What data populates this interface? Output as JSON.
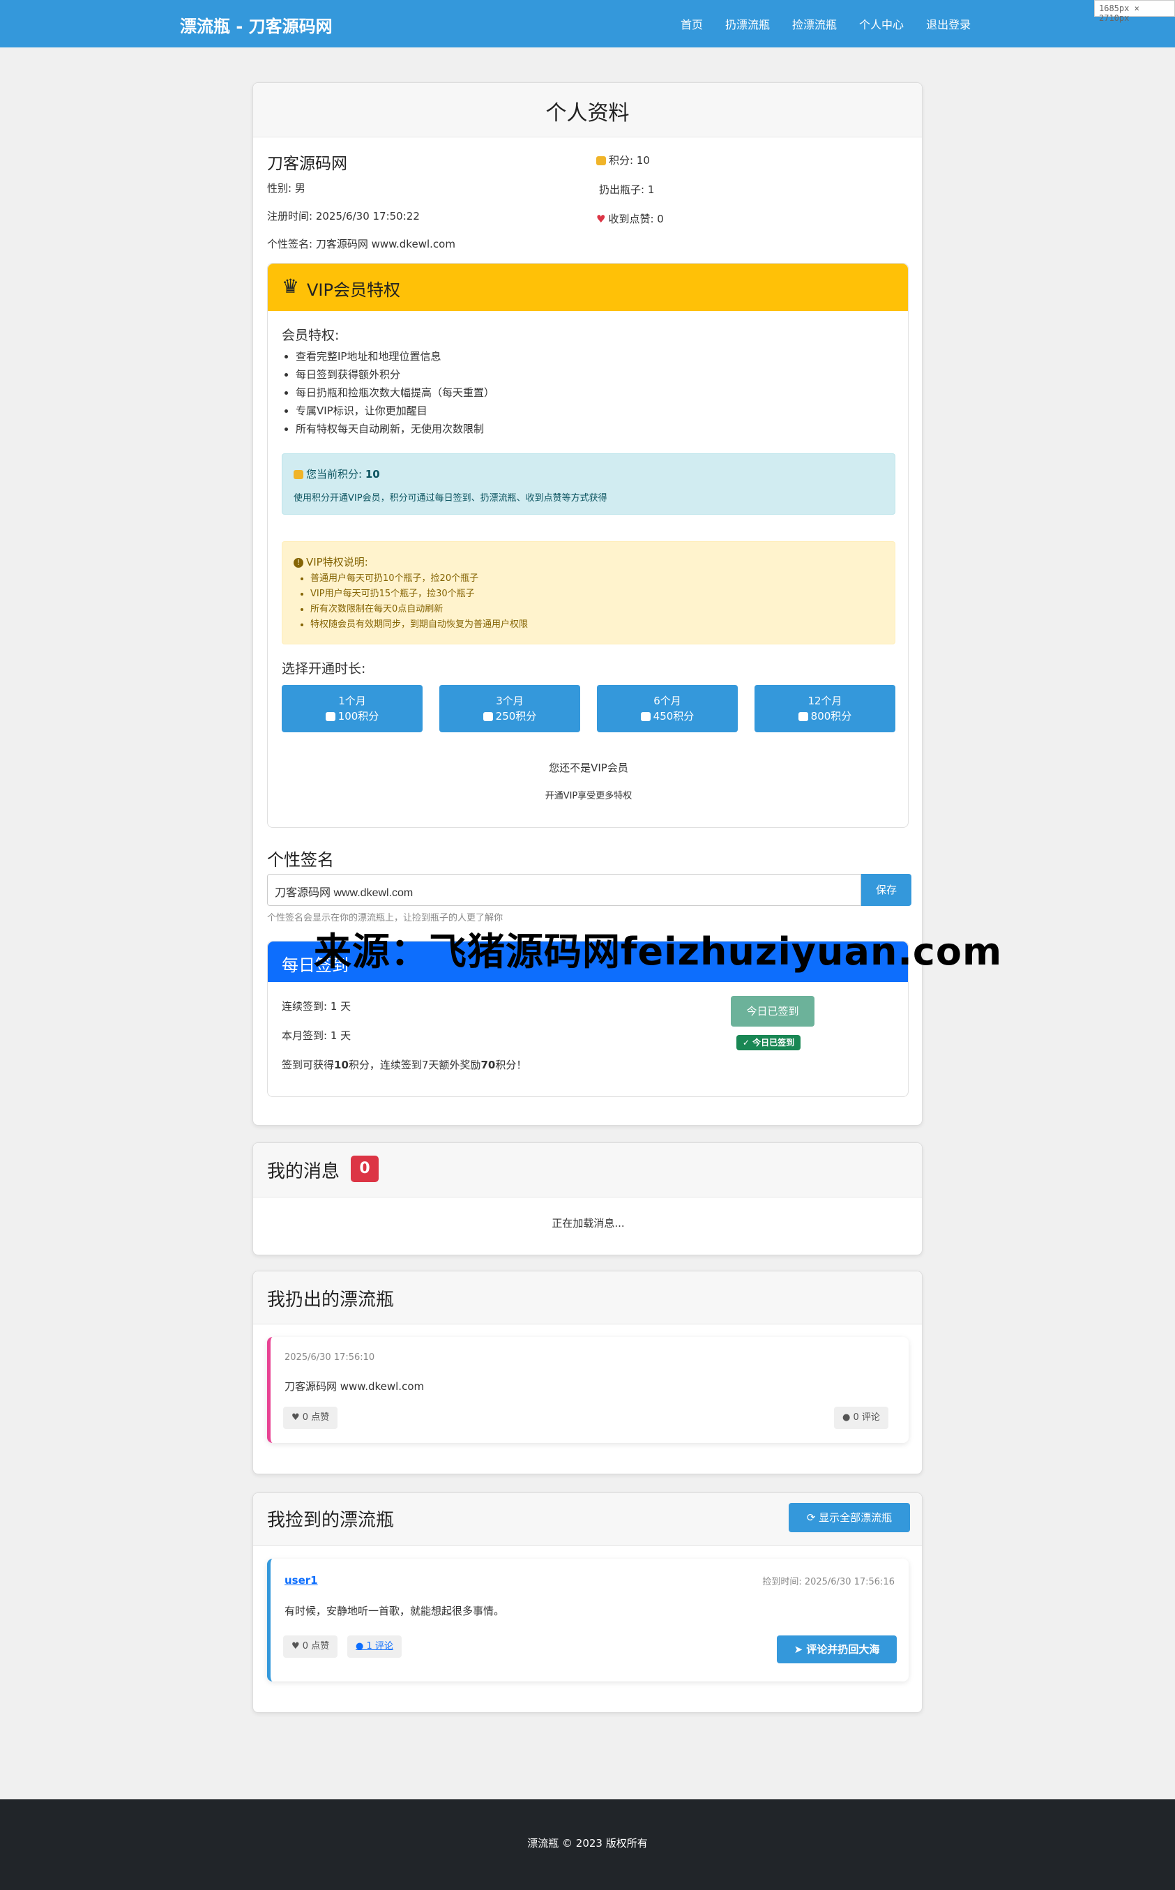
{
  "navbar": {
    "brand": "漂流瓶 - 刀客源码网",
    "links": [
      "首页",
      "扔漂流瓶",
      "捡漂流瓶",
      "个人中心",
      "退出登录"
    ]
  },
  "size_badge": "1685px × 2710px",
  "profile": {
    "title": "个人资料",
    "username": "刀客源码网",
    "gender": "性别: 男",
    "registered": "注册时间: 2025/6/30 17:50:22",
    "signature_line": "个性签名: 刀客源码网 www.dkewl.com",
    "points": "积分: 10",
    "thrown": "扔出瓶子: 1",
    "likes": "收到点赞: 0"
  },
  "vip": {
    "title": "VIP会员特权",
    "benefits_title": "会员特权:",
    "benefits": [
      "查看完整IP地址和地理位置信息",
      "每日签到获得额外积分",
      "每日扔瓶和捡瓶次数大幅提高（每天重置）",
      "专属VIP标识，让你更加醒目",
      "所有特权每天自动刷新，无使用次数限制"
    ],
    "current_points_label": "您当前积分: ",
    "current_points_value": "10",
    "points_note": "使用积分开通VIP会员，积分可通过每日签到、扔漂流瓶、收到点赞等方式获得",
    "notes_title": "VIP特权说明:",
    "notes": [
      "普通用户每天可扔10个瓶子，捡20个瓶子",
      "VIP用户每天可扔15个瓶子，捡30个瓶子",
      "所有次数限制在每天0点自动刷新",
      "特权随会员有效期同步，到期自动恢复为普通用户权限"
    ],
    "duration_label": "选择开通时长:",
    "plans": [
      {
        "name": "1个月",
        "cost": "100积分"
      },
      {
        "name": "3个月",
        "cost": "250积分"
      },
      {
        "name": "6个月",
        "cost": "450积分"
      },
      {
        "name": "12个月",
        "cost": "800积分"
      }
    ],
    "status": "您还不是VIP会员",
    "status_hint": "开通VIP享受更多特权"
  },
  "signature": {
    "heading": "个性签名",
    "value": "刀客源码网  www.dkewl.com",
    "save": "保存",
    "hint": "个性签名会显示在你的漂流瓶上，让捡到瓶子的人更了解你"
  },
  "watermark": "来源：飞猪源码网feizhuziyuan.com",
  "checkin": {
    "title": "每日签到",
    "streak": "连续签到: 1 天",
    "month": "本月签到: 1 天",
    "reward_pre": "签到可获得",
    "reward_points": "10",
    "reward_mid": "积分，连续签到7天额外奖励",
    "reward_bonus": "70",
    "reward_post": "积分！",
    "button": "今日已签到",
    "badge": "今日已签到"
  },
  "messages": {
    "title": "我的消息",
    "count": "0",
    "loading": "正在加载消息..."
  },
  "thrown_bottles": {
    "title": "我扔出的漂流瓶",
    "items": [
      {
        "time": "2025/6/30 17:56:10",
        "content": "刀客源码网 www.dkewl.com",
        "likes": "0 点赞",
        "comments": "0 评论"
      }
    ]
  },
  "picked_bottles": {
    "title": "我捡到的漂流瓶",
    "show_all": "显示全部漂流瓶",
    "items": [
      {
        "user": "user1",
        "picked_time": "捡到时间: 2025/6/30 17:56:16",
        "content": "有时候，安静地听一首歌，就能想起很多事情。",
        "likes": "0 点赞",
        "comments": "1 评论",
        "action": "评论并扔回大海"
      }
    ]
  },
  "footer": {
    "text": "漂流瓶 © 2023 版权所有"
  },
  "colors": {
    "primary": "#3498db",
    "vip_yellow": "#ffc107",
    "checkin_blue": "#0d6efd",
    "danger": "#dc3545",
    "success": "#198754"
  }
}
